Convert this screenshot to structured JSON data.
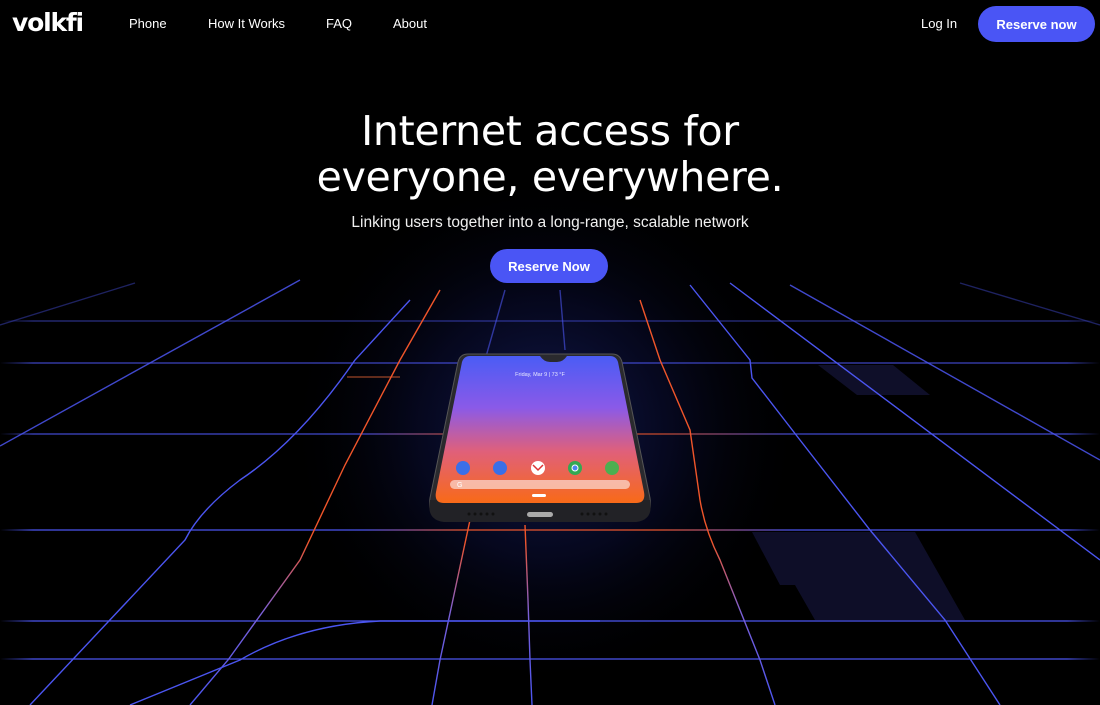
{
  "brand": {
    "logo": "volkfi"
  },
  "nav": {
    "links": [
      "Phone",
      "How It Works",
      "FAQ",
      "About"
    ],
    "login": "Log In",
    "cta": "Reserve now"
  },
  "hero": {
    "title_line1": "Internet access for",
    "title_line2": "everyone, everywhere.",
    "subtitle": "Linking users together into a long-range, scalable network",
    "cta": "Reserve Now"
  },
  "phone": {
    "lockscreen_text": "Friday, Mar 9  |  73 °F",
    "dock_apps": [
      "phone-app",
      "messages-app",
      "gmail-app",
      "chrome-app",
      "maps-app"
    ],
    "search_glyph": "G"
  },
  "colors": {
    "accent": "#4a55f5",
    "grid_blue": "#4b55f0",
    "grid_orange": "#f0552a",
    "background": "#000000"
  }
}
